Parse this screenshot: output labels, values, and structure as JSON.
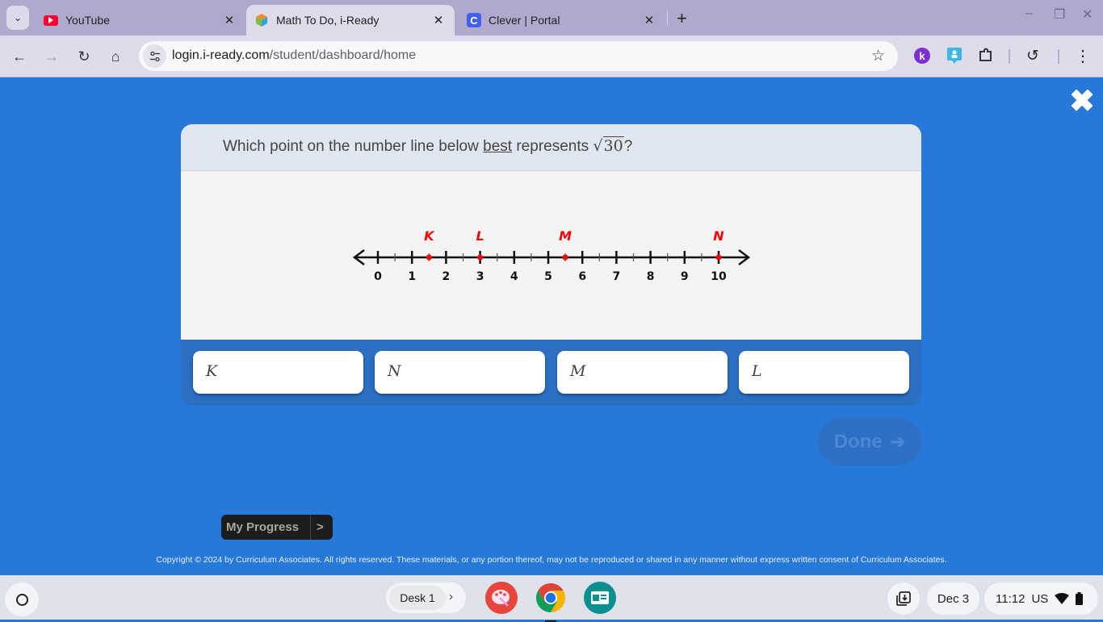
{
  "browser": {
    "tabs": [
      {
        "title": "YouTube",
        "icon": "youtube-icon",
        "active": false
      },
      {
        "title": "Math To Do, i-Ready",
        "icon": "iready-cube-icon",
        "active": true
      },
      {
        "title": "Clever | Portal",
        "icon": "clever-icon",
        "active": false
      }
    ],
    "tab_search_glyph": "⌄",
    "close_glyph": "✕",
    "new_tab_glyph": "+",
    "window_controls": {
      "minimize": "–",
      "restore": "❐",
      "close": "✕"
    },
    "url_host": "login.i-ready.com",
    "url_path": "/student/dashboard/home",
    "nav": {
      "back": "←",
      "forward": "→",
      "reload": "↻",
      "home": "⌂"
    },
    "star_glyph": "☆",
    "menu_glyph": "⋮",
    "history_glyph": "↺",
    "extension_k_label": "k"
  },
  "lesson": {
    "close_glyph": "✖",
    "question_prefix": "Which point on the number line below ",
    "question_emphasis": "best",
    "question_mid": " represents ",
    "radical_symbol": "√",
    "radicand": "30",
    "question_suffix": "?",
    "number_line": {
      "min": 0,
      "max": 10,
      "major_ticks": [
        0,
        1,
        2,
        3,
        4,
        5,
        6,
        7,
        8,
        9,
        10
      ],
      "minor_step": 0.5,
      "points": [
        {
          "label": "K",
          "value": 1.5
        },
        {
          "label": "L",
          "value": 3
        },
        {
          "label": "M",
          "value": 5.5
        },
        {
          "label": "N",
          "value": 10
        }
      ],
      "point_color": "#ff0000"
    },
    "answers": [
      "K",
      "N",
      "M",
      "L"
    ],
    "done_label": "Done",
    "done_arrow": "➔",
    "my_progress_label": "My Progress",
    "my_progress_arrow": ">",
    "copyright": "Copyright © 2024 by Curriculum Associates. All rights reserved. These materials, or any portion thereof, may not be reproduced or shared in any manner without express written consent of Curriculum Associates."
  },
  "shelf": {
    "desk_label": "Desk 1",
    "desk_chevron": "›",
    "date": "Dec 3",
    "time": "11:12",
    "locale": "US"
  },
  "colors": {
    "page_bg": "#2679d9",
    "tabstrip_bg": "#b1a9cd",
    "toolbar_bg": "#dedbea",
    "point_red": "#ff0000"
  }
}
